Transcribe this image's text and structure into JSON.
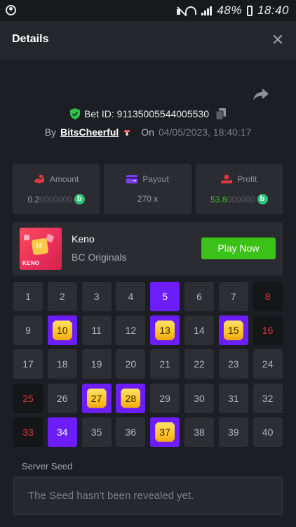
{
  "status_bar": {
    "battery": "48%",
    "time": "18:40"
  },
  "header": {
    "title": "Details",
    "close_label": "✕"
  },
  "bet": {
    "id_label": "Bet ID: 91135005544005530",
    "by_label": "By",
    "username": "BitsCheerful",
    "on_label": "On",
    "date": "04/05/2023, 18:40:17"
  },
  "stats": {
    "amount": {
      "label": "Amount",
      "value_main": "0.2",
      "value_dim": "0000000"
    },
    "payout": {
      "label": "Payout",
      "value": "270 x"
    },
    "profit": {
      "label": "Profit",
      "value_main": "53.8",
      "value_dim": "000000"
    }
  },
  "game": {
    "name": "Keno",
    "provider": "BC Originals",
    "thumb_number": "12",
    "thumb_word": "KENO",
    "play_label": "Play Now"
  },
  "grid": {
    "numbers": [
      1,
      2,
      3,
      4,
      5,
      6,
      7,
      8,
      9,
      10,
      11,
      12,
      13,
      14,
      15,
      16,
      17,
      18,
      19,
      20,
      21,
      22,
      23,
      24,
      25,
      26,
      27,
      28,
      29,
      30,
      31,
      32,
      33,
      34,
      35,
      36,
      37,
      38,
      39,
      40
    ],
    "picked_only": [
      5,
      34
    ],
    "hits": [
      10,
      13,
      15,
      27,
      28,
      37
    ],
    "misses": [
      8,
      16,
      25,
      33
    ]
  },
  "seed": {
    "label": "Server Seed",
    "message": "The Seed hasn't been revealed yet."
  },
  "colors": {
    "accent_purple": "#6c1dfa",
    "play_green": "#3bc117",
    "profit_green": "#37c12d",
    "miss_red": "#e0373f",
    "gem_yellow": "#ffc92b"
  }
}
